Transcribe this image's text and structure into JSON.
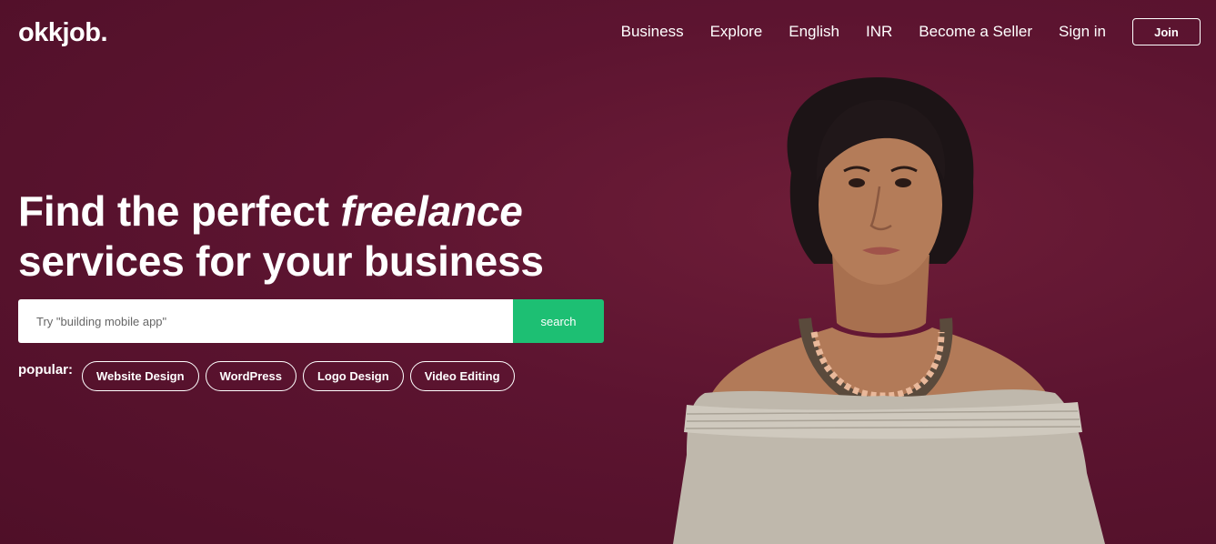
{
  "header": {
    "logo": "okkjob.",
    "nav": [
      {
        "label": "Business"
      },
      {
        "label": "Explore"
      },
      {
        "label": "English"
      },
      {
        "label": "INR"
      },
      {
        "label": "Become a Seller"
      },
      {
        "label": "Sign in"
      }
    ],
    "join_label": "Join"
  },
  "hero": {
    "title_part1": "Find the perfect ",
    "title_emphasis": "freelance",
    "title_part2": "services for your business"
  },
  "search": {
    "placeholder": "Try \"building mobile app\"",
    "value": "",
    "button_label": "search",
    "button_color": "#1dbf73"
  },
  "popular": {
    "label": "popular:",
    "tags": [
      {
        "label": "Website Design"
      },
      {
        "label": "WordPress"
      },
      {
        "label": "Logo Design"
      },
      {
        "label": "Video Editing"
      }
    ]
  },
  "colors": {
    "background": "#5c1430",
    "accent": "#1dbf73"
  }
}
